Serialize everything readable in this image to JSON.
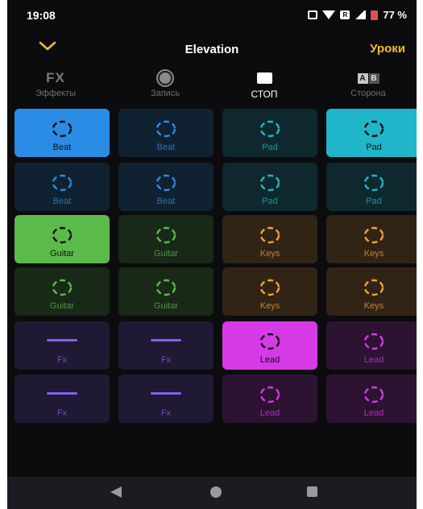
{
  "status_bar": {
    "time": "19:08",
    "sim_badge": "R",
    "battery": "77 %"
  },
  "header": {
    "title": "Elevation",
    "lessons": "Уроки"
  },
  "toolbar": [
    {
      "id": "fx",
      "glyph": "FX",
      "label": "Эффекты",
      "active": false
    },
    {
      "id": "record",
      "label": "Запись",
      "active": false
    },
    {
      "id": "stop",
      "label": "СТОП",
      "active": true
    },
    {
      "id": "side",
      "glyph_a": "A",
      "glyph_b": "B",
      "label": "Сторона",
      "active": false
    }
  ],
  "colors": {
    "blue": "#2a8ce4",
    "cyan": "#1fb6c9",
    "green": "#5bbb4a",
    "orange": "#f0a23a",
    "magenta": "#d63ae6",
    "purple": "#8a5cf0",
    "accent": "#f5b82e"
  },
  "pad_rows": [
    [
      {
        "label": "Beat",
        "color": "blue",
        "active": true,
        "icon": "loop-icon"
      },
      {
        "label": "Beat",
        "color": "blue",
        "active": false,
        "icon": "loop-icon"
      },
      {
        "label": "Pad",
        "color": "cyan",
        "active": false,
        "icon": "loop-icon"
      },
      {
        "label": "Pad",
        "color": "cyan",
        "active": true,
        "icon": "loop-icon"
      }
    ],
    [
      {
        "label": "Beat",
        "color": "blue",
        "active": false,
        "icon": "loop-icon"
      },
      {
        "label": "Beat",
        "color": "blue",
        "active": false,
        "icon": "loop-icon"
      },
      {
        "label": "Pad",
        "color": "cyan",
        "active": false,
        "icon": "loop-icon"
      },
      {
        "label": "Pad",
        "color": "cyan",
        "active": false,
        "icon": "loop-icon"
      }
    ],
    [
      {
        "label": "Guitar",
        "color": "green",
        "active": true,
        "icon": "loop-icon"
      },
      {
        "label": "Guitar",
        "color": "green",
        "active": false,
        "icon": "loop-icon"
      },
      {
        "label": "Keys",
        "color": "orange",
        "active": false,
        "icon": "loop-icon"
      },
      {
        "label": "Keys",
        "color": "orange",
        "active": false,
        "icon": "loop-icon"
      }
    ],
    [
      {
        "label": "Guitar",
        "color": "green",
        "active": false,
        "icon": "loop-icon"
      },
      {
        "label": "Guitar",
        "color": "green",
        "active": false,
        "icon": "loop-icon"
      },
      {
        "label": "Keys",
        "color": "orange",
        "active": false,
        "icon": "loop-icon"
      },
      {
        "label": "Keys",
        "color": "orange",
        "active": false,
        "icon": "loop-icon"
      }
    ],
    [
      {
        "label": "Fx",
        "color": "purple",
        "active": false,
        "icon": "line-icon"
      },
      {
        "label": "Fx",
        "color": "purple",
        "active": false,
        "icon": "line-icon"
      },
      {
        "label": "Lead",
        "color": "magenta",
        "active": true,
        "icon": "loop-icon"
      },
      {
        "label": "Lead",
        "color": "magenta",
        "active": false,
        "icon": "loop-icon"
      }
    ],
    [
      {
        "label": "Fx",
        "color": "purple",
        "active": false,
        "icon": "line-icon"
      },
      {
        "label": "Fx",
        "color": "purple",
        "active": false,
        "icon": "line-icon"
      },
      {
        "label": "Lead",
        "color": "magenta",
        "active": false,
        "icon": "loop-icon"
      },
      {
        "label": "Lead",
        "color": "magenta",
        "active": false,
        "icon": "loop-icon"
      }
    ]
  ]
}
